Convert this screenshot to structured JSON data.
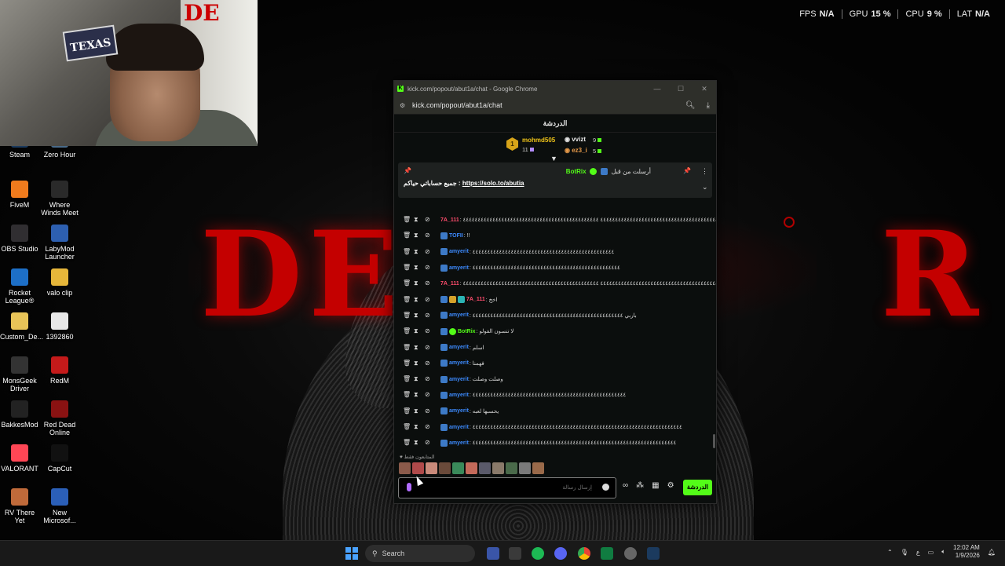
{
  "hw": [
    {
      "label": "FPS",
      "value": "N/A"
    },
    {
      "label": "GPU",
      "value": "15 %"
    },
    {
      "label": "CPU",
      "value": "9 %"
    },
    {
      "label": "LAT",
      "value": "N/A"
    }
  ],
  "webcam_sign": "TEXAS",
  "desktop": [
    {
      "label": "Steam",
      "color": "#1b3a5e"
    },
    {
      "label": "Zero Hour",
      "color": "#4a6b8a"
    },
    {
      "label": "FiveM",
      "color": "#f07b1d"
    },
    {
      "label": "Where Winds Meet",
      "color": "#2a2a2a"
    },
    {
      "label": "OBS Studio",
      "color": "#302e31"
    },
    {
      "label": "LabyMod Launcher",
      "color": "#2d5fb0"
    },
    {
      "label": "Rocket League®",
      "color": "#1d6fc7"
    },
    {
      "label": "valo clip",
      "color": "#e6b63a"
    },
    {
      "label": "Custom_De...",
      "color": "#e8c458"
    },
    {
      "label": "1392860",
      "color": "#e8e8e8"
    },
    {
      "label": "MonsGeek Driver",
      "color": "#333"
    },
    {
      "label": "RedM",
      "color": "#c41a1a"
    },
    {
      "label": "BakkesMod",
      "color": "#222"
    },
    {
      "label": "Red Dead Online",
      "color": "#8a1212"
    },
    {
      "label": "VALORANT",
      "color": "#ff4655"
    },
    {
      "label": "CapCut",
      "color": "#111"
    },
    {
      "label": "RV There Yet",
      "color": "#c06a3a"
    },
    {
      "label": "New Microsof...",
      "color": "#2b5fb8"
    }
  ],
  "window": {
    "title": "kick.com/popout/abut1a/chat - Google Chrome",
    "url": "kick.com/popout/abut1a/chat"
  },
  "chat": {
    "header": "الدردشة",
    "leaderboard": {
      "rank": "1",
      "first": {
        "name": "mohmd505",
        "count": "11"
      },
      "second": {
        "name": "vvizt",
        "count": "9"
      },
      "third": {
        "name": "ez3_i",
        "count": "5"
      }
    },
    "pinned": {
      "label": "أرسلت من قبل",
      "author": "BotRix",
      "text": "جميع حساباتي حياكم :",
      "link": "https://solo.to/abutia"
    },
    "messages": [
      {
        "user": "7A_111",
        "color": "#ff4d6d",
        "badges": [
          "b-blue",
          "b-crown",
          "b-teal"
        ],
        "text": ": ٤٤٤٤٤٤٤٤٤٤٤٤٤٤٤٤٤٤٤٤٤٤٤٤٤٤٤٤٤٤٤٤٤٤٤٤٤٤٤٤٤ ٤٤٤٤٤٤٤٤٤٤٤٤٤٤٤٤٤٤٤٤٤٤٤٤٤٤٤٤٤٤٤٤٤٤٤٤٤٤٤٤٤٤٤٤٤٤"
      },
      {
        "user": "TOFII",
        "color": "#3d8bff",
        "badges": [
          "b-blue"
        ],
        "text": ": !!"
      },
      {
        "user": "amyerit",
        "color": "#3d8bff",
        "badges": [
          "b-blue"
        ],
        "text": ": ٤٤٤٤٤٤٤٤٤٤٤٤٤٤٤٤٤٤٤٤٤٤٤٤٤٤٤٤٤٤٤٤٤٤٤٤٤٤٤٤٤٤٤٤٤٤٤٤"
      },
      {
        "user": "amyerit",
        "color": "#3d8bff",
        "badges": [
          "b-blue"
        ],
        "text": ": ٤٤٤٤٤٤٤٤٤٤٤٤٤٤٤٤٤٤٤٤٤٤٤٤٤٤٤٤٤٤٤٤٤٤٤٤٤٤٤٤٤٤٤٤٤٤٤٤٤٤"
      },
      {
        "user": "7A_111",
        "color": "#ff4d6d",
        "badges": [
          "b-blue",
          "b-crown",
          "b-teal"
        ],
        "text": ": ٤٤٤٤٤٤٤٤٤٤٤٤٤٤٤٤٤٤٤٤٤٤٤٤٤٤٤٤٤٤٤٤٤٤٤٤٤٤٤٤٤ ٤٤٤٤٤٤٤٤٤٤٤٤٤٤٤٤٤٤٤٤٤٤٤٤٤٤٤٤٤٤٤٤٤٤٤٤٤٤٤٤٤٤٤٤٤٤"
      },
      {
        "user": "7A_111",
        "color": "#ff4d6d",
        "badges": [
          "b-blue",
          "b-crown",
          "b-teal"
        ],
        "text": ": اخخ"
      },
      {
        "user": "amyerit",
        "color": "#3d8bff",
        "badges": [
          "b-blue"
        ],
        "text": ": باربي ٤٤٤٤٤٤٤٤٤٤٤٤٤٤٤٤٤٤٤٤٤٤٤٤٤٤٤٤٤٤٤٤٤٤٤٤٤٤٤٤٤٤٤٤٤٤٤٤٤٤٤"
      },
      {
        "user": "BotRix",
        "color": "#53fc18",
        "badges": [
          "b-blue",
          "b-ver"
        ],
        "text": ": لا تنسون الفولو"
      },
      {
        "user": "amyerit",
        "color": "#3d8bff",
        "badges": [
          "b-blue"
        ],
        "text": ": اسلم"
      },
      {
        "user": "amyerit",
        "color": "#3d8bff",
        "badges": [
          "b-blue"
        ],
        "text": ": فهمنا"
      },
      {
        "user": "amyerit",
        "color": "#3d8bff",
        "badges": [
          "b-blue"
        ],
        "text": ": وصلت وصلت"
      },
      {
        "user": "amyerit",
        "color": "#3d8bff",
        "badges": [
          "b-blue"
        ],
        "text": ": ٤٤٤٤٤٤٤٤٤٤٤٤٤٤٤٤٤٤٤٤٤٤٤٤٤٤٤٤٤٤٤٤٤٤٤٤٤٤٤٤٤٤٤٤٤٤٤٤٤٤٤٤"
      },
      {
        "user": "amyerit",
        "color": "#3d8bff",
        "badges": [
          "b-blue"
        ],
        "text": ": يحسبها لعبه"
      },
      {
        "user": "amyerit",
        "color": "#3d8bff",
        "badges": [
          "b-blue"
        ],
        "text": ": ٤٤٤٤٤٤٤٤٤٤٤٤٤٤٤٤٤٤٤٤٤٤٤٤٤٤٤٤٤٤٤٤٤٤٤٤٤٤٤٤٤٤٤٤٤٤٤٤٤٤٤٤٤٤٤٤٤٤٤٤٤٤٤٤٤٤٤٤٤٤٤"
      },
      {
        "user": "amyerit",
        "color": "#3d8bff",
        "badges": [
          "b-blue"
        ],
        "text": ": ٤٤٤٤٤٤٤٤٤٤٤٤٤٤٤٤٤٤٤٤٤٤٤٤٤٤٤٤٤٤٤٤٤٤٤٤٤٤٤٤٤٤٤٤٤٤٤٤٤٤٤٤٤٤٤٤٤٤٤٤٤٤٤٤٤٤٤٤٤"
      }
    ],
    "recent_label": "المتابعون فقط",
    "avatars": [
      "#8a5a4a",
      "#b04a4a",
      "#c98a7a",
      "#6a4a3a",
      "#3a8a5a",
      "#c46a5a",
      "#5a5a6a",
      "#8a7a6a",
      "#4a6a4a",
      "#7a7a7a",
      "#9a6a4a"
    ],
    "input_placeholder": "إرسال رسالة",
    "send_label": "الدردشة"
  },
  "taskbar": {
    "search": "Search",
    "time": "12:02 AM",
    "date": "1/9/2026",
    "lang": "ع"
  }
}
